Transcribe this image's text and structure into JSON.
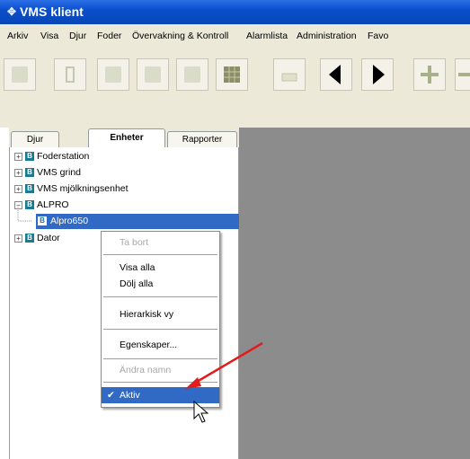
{
  "window": {
    "title": "VMS klient",
    "title_icon": "app-icon"
  },
  "menu": [
    "Arkiv",
    "Visa",
    "Djur",
    "Foder",
    "Övervakning & Kontroll",
    "Alarmlista",
    "Administration",
    "Favo"
  ],
  "toolbar": {
    "buttons": [
      "cow-icon",
      "milk-bottle-icon",
      "chart-icon",
      "report-icon",
      "graph-icon",
      "grid-icon",
      "print-icon",
      "back-arrow-icon",
      "forward-arrow-icon",
      "add-icon",
      "remove-icon"
    ]
  },
  "tabs": [
    "Djur",
    "Enheter",
    "Rapporter"
  ],
  "active_tab": "Enheter",
  "tree": {
    "items": [
      {
        "label": "Foderstation",
        "expander": "+"
      },
      {
        "label": "VMS grind",
        "expander": "+"
      },
      {
        "label": "VMS mjölkningsenhet",
        "expander": "+"
      },
      {
        "label": "ALPRO",
        "expander": "−"
      },
      {
        "label": "Alpro650",
        "selected": true
      },
      {
        "label": "Dator",
        "expander": "+"
      }
    ],
    "node_icon_letter": "B"
  },
  "context_menu": {
    "items": [
      {
        "label": "Ta bort",
        "disabled": true
      },
      {
        "label": "Visa alla"
      },
      {
        "label": "Dölj alla"
      },
      {
        "label": "Hierarkisk vy"
      },
      {
        "label": "Egenskaper..."
      },
      {
        "label": "Ändra namn",
        "disabled": true
      },
      {
        "label": "Aktiv",
        "checked": true,
        "highlighted": true
      }
    ]
  },
  "colors": {
    "titlebar": "#0a4fcc",
    "selection": "#316ac5",
    "workspace": "#8c8c8c",
    "annotation_arrow": "#e21b1b"
  }
}
